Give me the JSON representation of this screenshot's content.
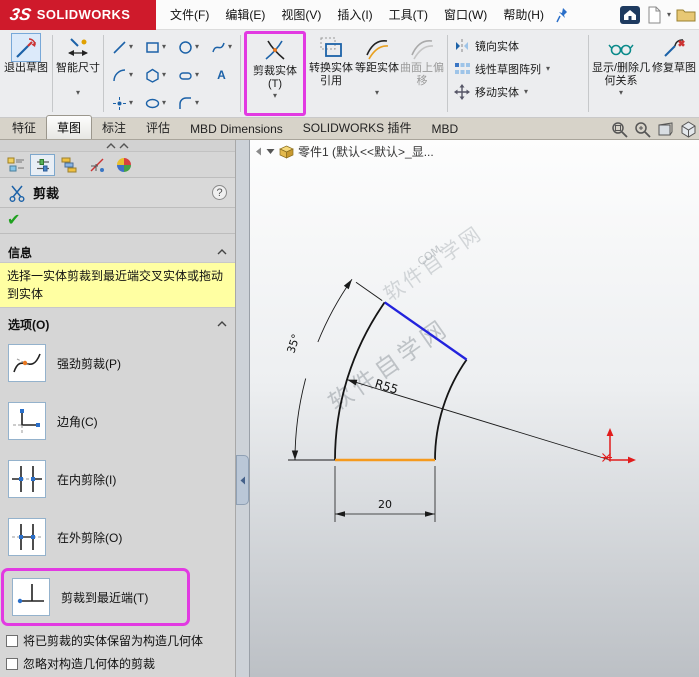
{
  "titlebar": {
    "logo_mark": "3S",
    "logo_brand": "SOLIDWORKS",
    "menu_items": [
      "文件(F)",
      "编辑(E)",
      "视图(V)",
      "插入(I)",
      "工具(T)",
      "窗口(W)",
      "帮助(H)"
    ]
  },
  "ribbon": {
    "exit_sketch": "退出草图",
    "smart_dimension": "智能尺寸",
    "trim_entities": "剪裁实体(T)",
    "convert_entities": "转换实体引用",
    "offset_entities": "等距实体",
    "surface_offset": "曲面上偏移",
    "mirror_entities": "镜向实体",
    "linear_sketch_pattern": "线性草图阵列",
    "move_entities": "移动实体",
    "display_delete_relations": "显示/删除几何关系",
    "repair_sketch": "修复草图"
  },
  "tabs": {
    "items": [
      "特征",
      "草图",
      "标注",
      "评估",
      "MBD Dimensions",
      "SOLIDWORKS 插件",
      "MBD"
    ],
    "active": "草图"
  },
  "panel": {
    "title": "剪裁",
    "help_glyph": "?",
    "ok_glyph": "✔",
    "info_header": "信息",
    "info_message": "选择一实体剪裁到最近端交叉实体或拖动到实体",
    "options_header": "选项(O)",
    "options": [
      {
        "label": "强劲剪裁(P)"
      },
      {
        "label": "边角(C)"
      },
      {
        "label": "在内剪除(I)"
      },
      {
        "label": "在外剪除(O)"
      },
      {
        "label": "剪裁到最近端(T)"
      }
    ],
    "checkboxes": [
      {
        "label": "将已剪裁的实体保留为构造几何体",
        "checked": false
      },
      {
        "label": "忽略对构造几何体的剪裁",
        "checked": false
      }
    ]
  },
  "graphics": {
    "feature_tree_label": "零件1 (默认<<默认>_显...",
    "watermark": "软件自学网",
    "watermark_domain": ".COM",
    "dimensions": {
      "radius": "R55",
      "angle": "35°",
      "width": "20"
    }
  },
  "icons": {
    "dropdown": "▾",
    "text_tool": "A"
  },
  "colors": {
    "brand_red": "#cf1a2b",
    "annotation_magenta": "#e23ae2",
    "info_yellow": "#ffffa2",
    "selected_blue": "#2323dd",
    "highlight_orange": "#f59a1d",
    "origin_red": "#e11c1c"
  }
}
